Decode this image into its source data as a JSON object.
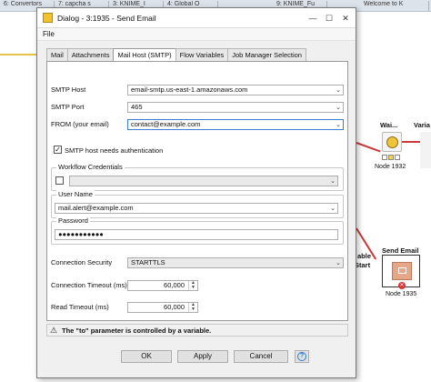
{
  "background": {
    "tabs": [
      "6: Convertors",
      "7: capcha s",
      "3: KNIME_I",
      "4: Global O",
      "9: KNIME_Fu",
      "Welcome to K"
    ],
    "nodes": {
      "wait_label_top": "Wai...",
      "var_label_top": "Varia",
      "wait_label_bottom": "Node 1932",
      "send_label_top": "Send Email",
      "send_label_bottom": "Node 1935",
      "side_text_1": "able",
      "side_text_2": "Start"
    }
  },
  "dialog": {
    "title": "Dialog - 3:1935 - Send Email",
    "menu": [
      "File"
    ],
    "tabs": [
      "Mail",
      "Attachments",
      "Mail Host (SMTP)",
      "Flow Variables",
      "Job Manager Selection"
    ],
    "active_tab": "Mail Host (SMTP)",
    "smtp_host": {
      "label": "SMTP Host",
      "value": "email-smtp.us-east-1.amazonaws.com"
    },
    "smtp_port": {
      "label": "SMTP Port",
      "value": "465"
    },
    "from": {
      "label": "FROM (your email)",
      "value": "contact@example.com"
    },
    "auth_checkbox": {
      "label": "SMTP host needs authentication",
      "checked": true
    },
    "workflow_credentials": {
      "title": "Workflow Credentials",
      "checked": false,
      "value": ""
    },
    "user_name": {
      "title": "User Name",
      "value": "mail.alert@example.com"
    },
    "password": {
      "title": "Password",
      "value": "●●●●●●●●●●●"
    },
    "connection_security": {
      "label": "Connection Security",
      "value": "STARTTLS"
    },
    "connection_timeout": {
      "label": "Connection Timeout (ms)",
      "value": "60,000"
    },
    "read_timeout": {
      "label": "Read Timeout (ms)",
      "value": "60,000"
    },
    "warning": "The \"to\" parameter is controlled by a variable.",
    "buttons": {
      "ok": "OK",
      "apply": "Apply",
      "cancel": "Cancel",
      "help": "?"
    }
  }
}
